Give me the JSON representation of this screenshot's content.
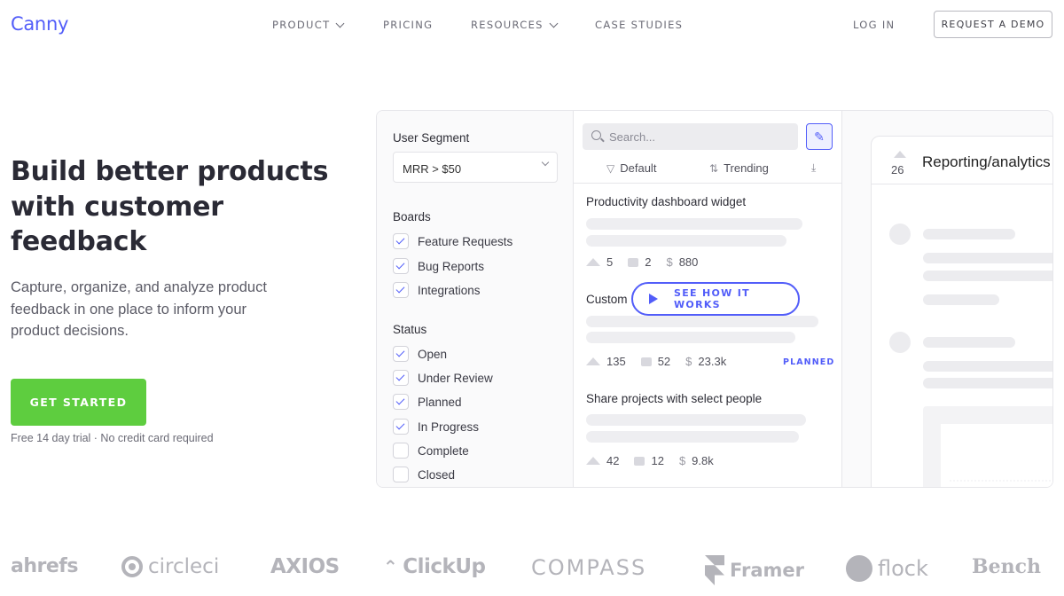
{
  "nav": {
    "logo": "Canny",
    "items": [
      {
        "label": "PRODUCT",
        "dropdown": true
      },
      {
        "label": "PRICING",
        "dropdown": false
      },
      {
        "label": "RESOURCES",
        "dropdown": true
      },
      {
        "label": "CASE STUDIES",
        "dropdown": false
      }
    ],
    "login": "LOG IN",
    "demo": "REQUEST A DEMO"
  },
  "hero": {
    "title": "Build better products with customer feedback",
    "subtitle": "Capture, organize, and analyze product feedback in one place to inform your product decisions.",
    "cta": "GET STARTED",
    "trial": "Free 14 day trial · No credit card required"
  },
  "mockup": {
    "filters_panel": {
      "segment_label": "User Segment",
      "segment_value": "MRR > $50",
      "boards_label": "Boards",
      "boards": [
        {
          "label": "Feature Requests",
          "checked": true
        },
        {
          "label": "Bug Reports",
          "checked": true
        },
        {
          "label": "Integrations",
          "checked": true
        }
      ],
      "status_label": "Status",
      "statuses": [
        {
          "label": "Open",
          "checked": true
        },
        {
          "label": "Under Review",
          "checked": true
        },
        {
          "label": "Planned",
          "checked": true
        },
        {
          "label": "In Progress",
          "checked": true
        },
        {
          "label": "Complete",
          "checked": false
        },
        {
          "label": "Closed",
          "checked": false
        }
      ]
    },
    "posts_panel": {
      "search_placeholder": "Search...",
      "filter_label": "Default",
      "sort_label": "Trending",
      "posts": [
        {
          "title": "Productivity dashboard widget",
          "votes": "5",
          "comments": "2",
          "mrr": "880",
          "status": ""
        },
        {
          "title": "Custom",
          "votes": "135",
          "comments": "52",
          "mrr": "23.3k",
          "status": "PLANNED"
        },
        {
          "title": "Share projects with select people",
          "votes": "42",
          "comments": "12",
          "mrr": "9.8k",
          "status": ""
        }
      ],
      "see_how": "SEE HOW IT WORKS"
    },
    "detail_panel": {
      "votes": "26",
      "title": "Reporting/analytics"
    }
  },
  "logos": [
    "ahrefs",
    "circleci",
    "AXIOS",
    "ClickUp",
    "COMPASS",
    "Framer",
    "flock",
    "Bench"
  ],
  "colors": {
    "brand": "#525df9",
    "cta": "#5ecd3f"
  }
}
